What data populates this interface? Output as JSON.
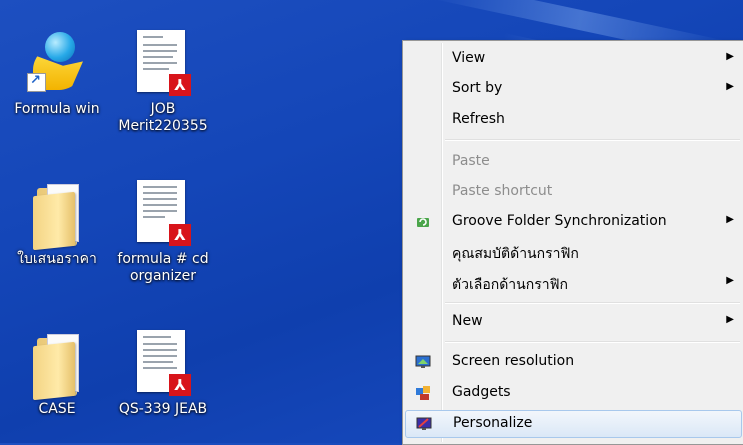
{
  "desktop": {
    "icons": [
      {
        "label": "Formula win",
        "kind": "shortcut"
      },
      {
        "label": "JOB Merit220355",
        "kind": "pdf"
      },
      {
        "label": "ใบเสนอราคา",
        "kind": "folder"
      },
      {
        "label": "formula # cd organizer",
        "kind": "pdf"
      },
      {
        "label": "CASE",
        "kind": "folder"
      },
      {
        "label": "QS-339 JEAB",
        "kind": "pdf"
      }
    ]
  },
  "menu": {
    "items": [
      {
        "label": "View",
        "submenu": true
      },
      {
        "label": "Sort by",
        "submenu": true
      },
      {
        "label": "Refresh"
      },
      {
        "label": "Paste",
        "disabled": true
      },
      {
        "label": "Paste shortcut",
        "disabled": true
      },
      {
        "label": "Groove Folder Synchronization",
        "submenu": true,
        "icon": "groove-sync-icon"
      },
      {
        "label": "คุณสมบัติด้านกราฟิก"
      },
      {
        "label": "ตัวเลือกด้านกราฟิก",
        "submenu": true
      },
      {
        "label": "New",
        "submenu": true
      },
      {
        "label": "Screen resolution",
        "icon": "monitor-icon"
      },
      {
        "label": "Gadgets",
        "icon": "gadgets-icon"
      },
      {
        "label": "Personalize",
        "icon": "personalize-icon",
        "highlighted": true
      }
    ],
    "arrow_glyph": "▶"
  },
  "colors": {
    "desktop_blue": "#1446b8",
    "menu_bg": "#f0f0f0",
    "highlight": "#dbe8f7",
    "pdf_red": "#d8141a"
  }
}
